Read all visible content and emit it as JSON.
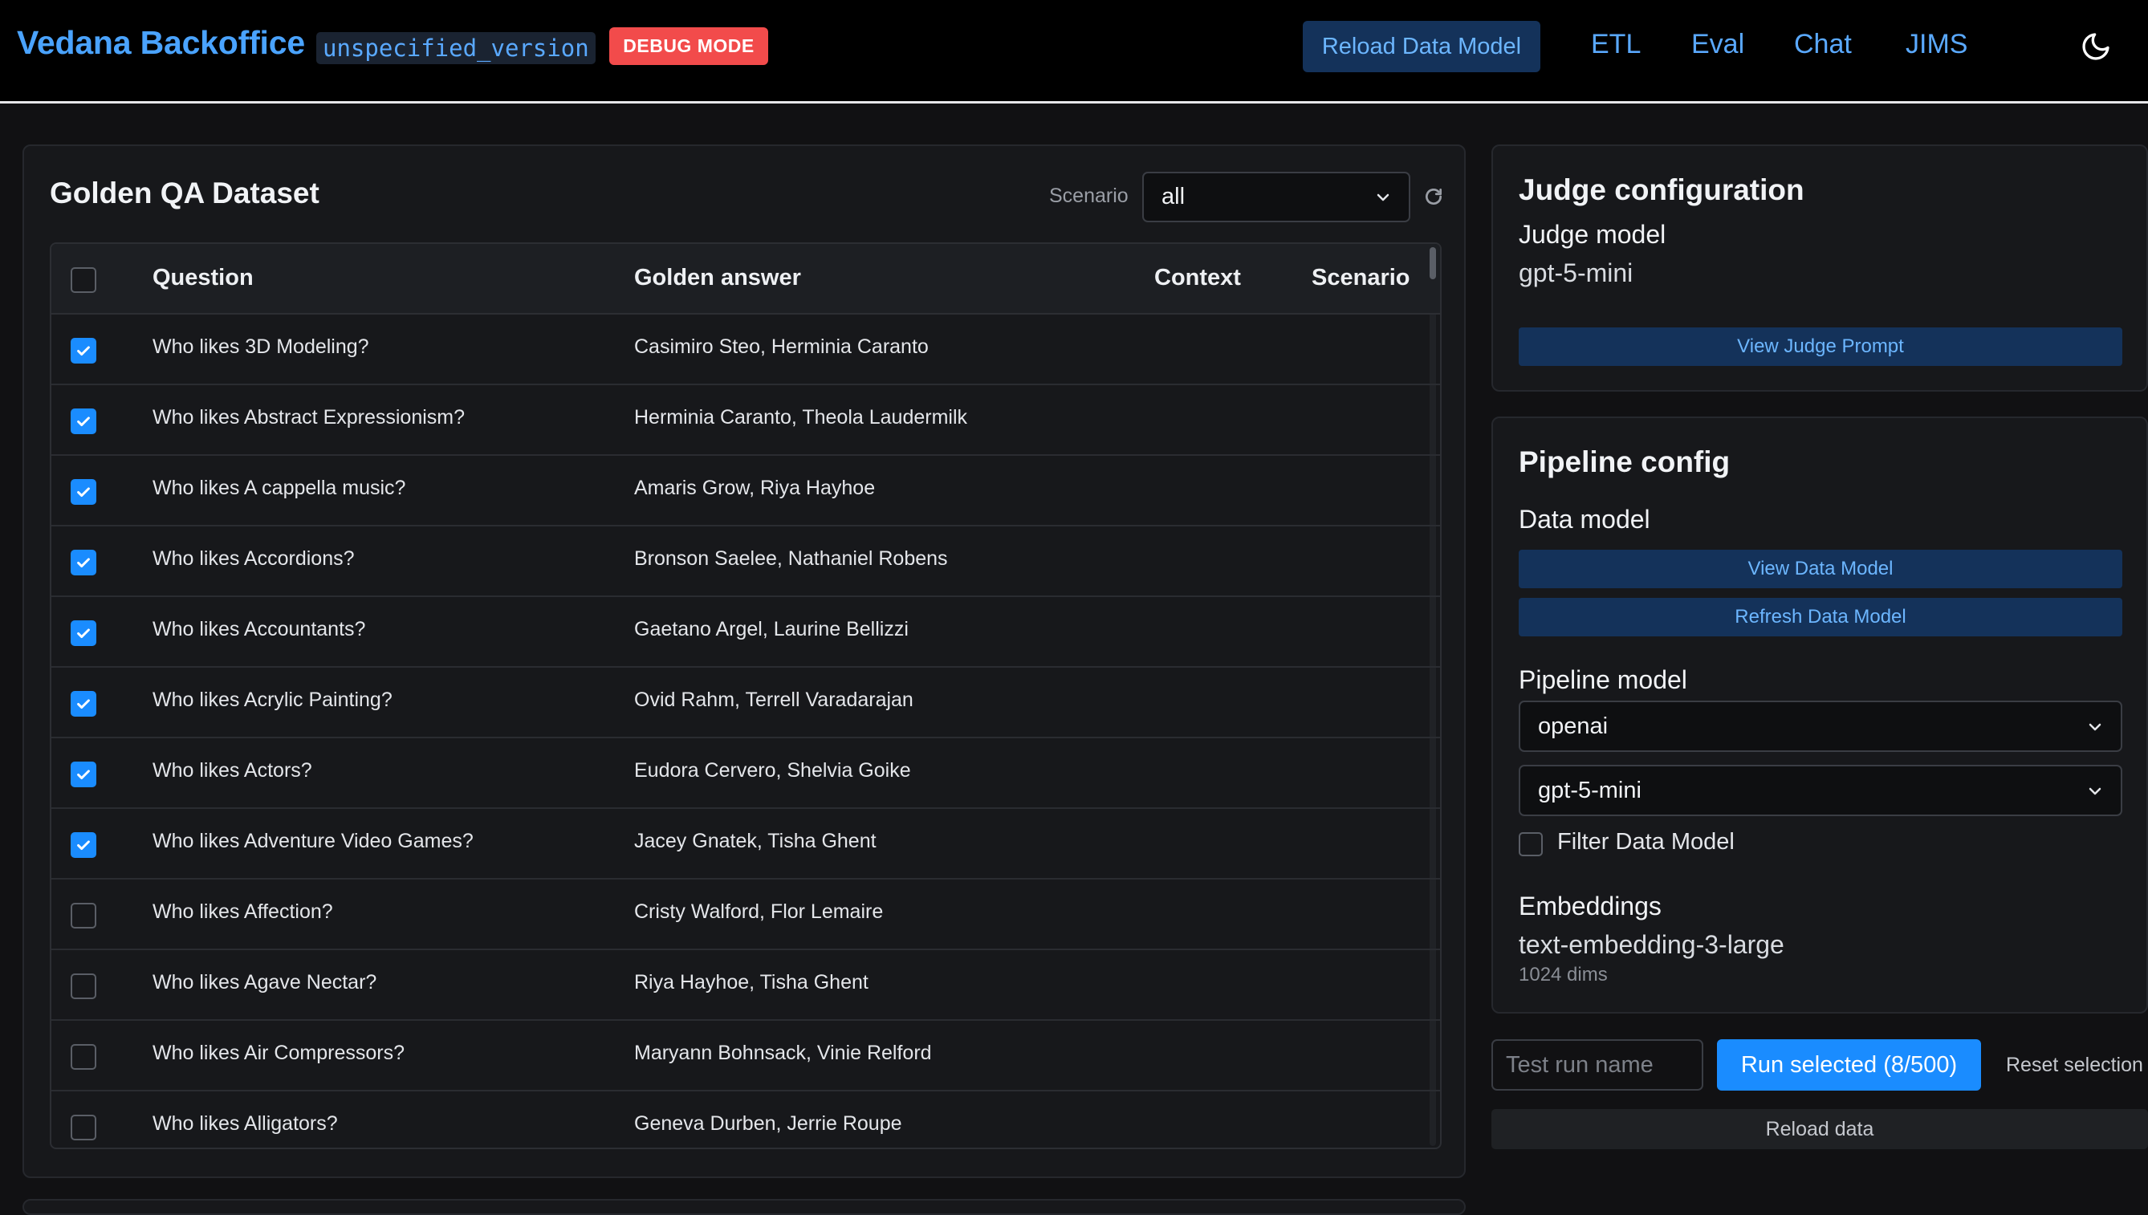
{
  "header": {
    "brand": "Vedana Backoffice",
    "version": "unspecified_version",
    "debug_badge": "DEBUG MODE",
    "reload_button": "Reload Data Model",
    "nav": [
      "ETL",
      "Eval",
      "Chat",
      "JIMS"
    ],
    "theme_icon": "moon-icon"
  },
  "qa": {
    "title": "Golden QA Dataset",
    "scenario_label": "Scenario",
    "scenario_value": "all",
    "columns": [
      "Question",
      "Golden answer",
      "Context",
      "Scenario"
    ],
    "rows": [
      {
        "checked": true,
        "question": "Who likes 3D Modeling?",
        "answer": "Casimiro Steo, Herminia Caranto",
        "context": "",
        "scenario": ""
      },
      {
        "checked": true,
        "question": "Who likes Abstract Expressionism?",
        "answer": "Herminia Caranto, Theola Laudermilk",
        "context": "",
        "scenario": ""
      },
      {
        "checked": true,
        "question": "Who likes A cappella music?",
        "answer": "Amaris Grow, Riya Hayhoe",
        "context": "",
        "scenario": ""
      },
      {
        "checked": true,
        "question": "Who likes Accordions?",
        "answer": "Bronson Saelee, Nathaniel Robens",
        "context": "",
        "scenario": ""
      },
      {
        "checked": true,
        "question": "Who likes Accountants?",
        "answer": "Gaetano Argel, Laurine Bellizzi",
        "context": "",
        "scenario": ""
      },
      {
        "checked": true,
        "question": "Who likes Acrylic Painting?",
        "answer": "Ovid Rahm, Terrell Varadarajan",
        "context": "",
        "scenario": ""
      },
      {
        "checked": true,
        "question": "Who likes Actors?",
        "answer": "Eudora Cervero, Shelvia Goike",
        "context": "",
        "scenario": ""
      },
      {
        "checked": true,
        "question": "Who likes Adventure Video Games?",
        "answer": "Jacey Gnatek, Tisha Ghent",
        "context": "",
        "scenario": ""
      },
      {
        "checked": false,
        "question": "Who likes Affection?",
        "answer": "Cristy Walford, Flor Lemaire",
        "context": "",
        "scenario": ""
      },
      {
        "checked": false,
        "question": "Who likes Agave Nectar?",
        "answer": "Riya Hayhoe, Tisha Ghent",
        "context": "",
        "scenario": ""
      },
      {
        "checked": false,
        "question": "Who likes Air Compressors?",
        "answer": "Maryann Bohnsack, Vinie Relford",
        "context": "",
        "scenario": ""
      },
      {
        "checked": false,
        "question": "Who likes Alligators?",
        "answer": "Geneva Durben, Jerrie Roupe",
        "context": "",
        "scenario": ""
      }
    ]
  },
  "judge": {
    "title": "Judge configuration",
    "model_label": "Judge model",
    "model_value": "gpt-5-mini",
    "view_prompt_button": "View Judge Prompt"
  },
  "pipeline": {
    "title": "Pipeline config",
    "data_model_label": "Data model",
    "view_data_model_button": "View Data Model",
    "refresh_data_model_button": "Refresh Data Model",
    "pipeline_model_label": "Pipeline model",
    "provider_value": "openai",
    "model_value": "gpt-5-mini",
    "filter_label": "Filter Data Model",
    "filter_checked": false,
    "embeddings_label": "Embeddings",
    "embeddings_model": "text-embedding-3-large",
    "embeddings_dims": "1024 dims"
  },
  "run": {
    "name_placeholder": "Test run name",
    "run_button": "Run selected (8/500)",
    "reset_link": "Reset selection",
    "reload_data_button": "Reload data"
  },
  "colors": {
    "accent": "#1a8cff",
    "brand": "#4aa3ff",
    "debug": "#f24b4b",
    "background": "#111113",
    "panel": "#17181b"
  }
}
